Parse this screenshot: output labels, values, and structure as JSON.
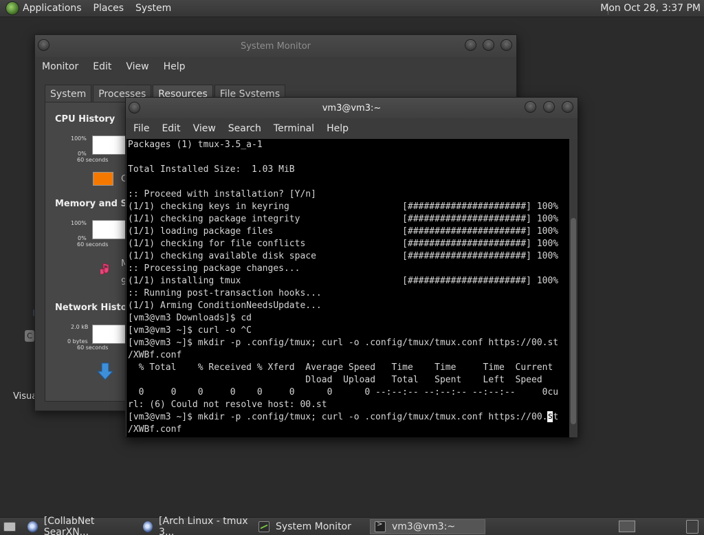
{
  "top_panel": {
    "menus": [
      "Applications",
      "Places",
      "System"
    ],
    "clock": "Mon Oct 28,  3:37 PM"
  },
  "desktop": {
    "label": "Visua"
  },
  "system_monitor": {
    "title": "System Monitor",
    "menus": [
      "Monitor",
      "Edit",
      "View",
      "Help"
    ],
    "tabs": [
      "System",
      "Processes",
      "Resources",
      "File Systems"
    ],
    "active_tab": "Resources",
    "cpu": {
      "title": "CPU History",
      "y_top": "100%",
      "y_bottom": "0%",
      "x_label": "60 seconds",
      "legend_fragment": "C"
    },
    "memory": {
      "title": "Memory and Swa",
      "y_top": "100%",
      "y_bottom": "0%",
      "x_label": "60 seconds",
      "legend_fragment_1": "M",
      "legend_fragment_2": "9"
    },
    "network": {
      "title": "Network History",
      "y_top": "2.0 kB",
      "y_bottom": "0 bytes",
      "x_label": "60 seconds"
    }
  },
  "terminal": {
    "title": "vm3@vm3:~",
    "menus": [
      "File",
      "Edit",
      "View",
      "Search",
      "Terminal",
      "Help"
    ],
    "lines": [
      "Packages (1) tmux-3.5_a-1",
      "",
      "Total Installed Size:  1.03 MiB",
      "",
      ":: Proceed with installation? [Y/n]",
      "(1/1) checking keys in keyring                     [######################] 100%",
      "(1/1) checking package integrity                   [######################] 100%",
      "(1/1) loading package files                        [######################] 100%",
      "(1/1) checking for file conflicts                  [######################] 100%",
      "(1/1) checking available disk space                [######################] 100%",
      ":: Processing package changes...",
      "(1/1) installing tmux                              [######################] 100%",
      ":: Running post-transaction hooks...",
      "(1/1) Arming ConditionNeedsUpdate...",
      "[vm3@vm3 Downloads]$ cd",
      "[vm3@vm3 ~]$ curl -o ^C",
      "[vm3@vm3 ~]$ mkdir -p .config/tmux; curl -o .config/tmux/tmux.conf https://00.st",
      "/XWBf.conf",
      "  % Total    % Received % Xferd  Average Speed   Time    Time     Time  Current",
      "                                 Dload  Upload   Total   Spent    Left  Speed",
      "  0     0    0     0    0     0      0      0 --:--:-- --:--:-- --:--:--     0cu",
      "rl: (6) Could not resolve host: 00.st"
    ],
    "last_line_before_cursor": "[vm3@vm3 ~]$ mkdir -p .config/tmux; curl -o .config/tmux/tmux.conf https://00.",
    "cursor_char": "s",
    "last_line_after_cursor": "t",
    "wrapped_line": "/XWBf.conf"
  },
  "taskbar": {
    "tasks": [
      {
        "label": "[CollabNet SearXN...",
        "icon": "browser-icon"
      },
      {
        "label": "[Arch Linux - tmux 3...",
        "icon": "browser-icon"
      },
      {
        "label": "System Monitor",
        "icon": "system-monitor-icon"
      },
      {
        "label": "vm3@vm3:~",
        "icon": "terminal-icon"
      }
    ]
  }
}
